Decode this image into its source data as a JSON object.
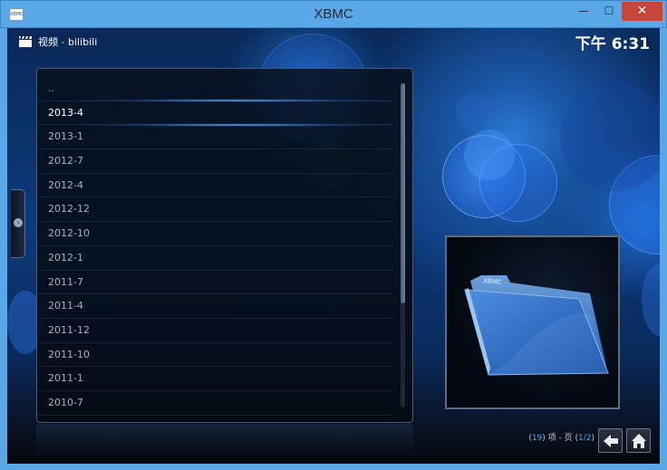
{
  "window": {
    "icon_text": "XBMC",
    "title": "XBMC",
    "minimize_glyph": "—",
    "maximize_glyph": "☐",
    "close_glyph": "✕"
  },
  "header": {
    "section": "视频",
    "separator": " - ",
    "path": "bilibili",
    "clock": "下午 6:31"
  },
  "list": {
    "items": [
      {
        "label": ".."
      },
      {
        "label": "2013-4"
      },
      {
        "label": "2013-1"
      },
      {
        "label": "2012-7"
      },
      {
        "label": "2012-4"
      },
      {
        "label": "2012-12"
      },
      {
        "label": "2012-10"
      },
      {
        "label": "2012-1"
      },
      {
        "label": "2011-7"
      },
      {
        "label": "2011-4"
      },
      {
        "label": "2011-12"
      },
      {
        "label": "2011-10"
      },
      {
        "label": "2011-1"
      },
      {
        "label": "2010-7"
      }
    ],
    "focused_index": 1,
    "scroll_thumb_fraction": 0.68
  },
  "footer": {
    "open_paren": "(",
    "item_count": "19",
    "items_label": ") 项 - 页 (",
    "page": "1/2",
    "close_paren": ")"
  },
  "thumbnail": {
    "folder_label": "XBMC"
  },
  "colors": {
    "accent": "#4aa3ff",
    "titlebar": "#5aa7e8",
    "close_button": "#c7463c"
  },
  "icons": {
    "app": "xbmc-app-icon",
    "header": "clapperboard-icon",
    "side_tab": "chevron-right-icon",
    "back": "back-arrow-icon",
    "home": "home-icon",
    "thumbnail": "folder-icon"
  }
}
